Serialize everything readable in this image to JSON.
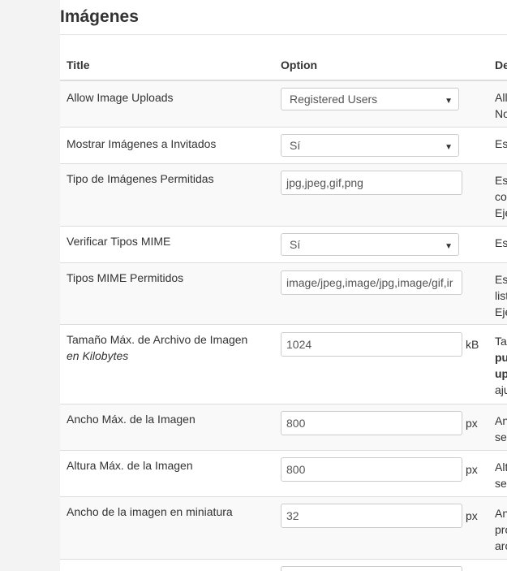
{
  "page": {
    "title": "Imágenes"
  },
  "table": {
    "headers": {
      "title": "Title",
      "option": "Option",
      "description": "De"
    },
    "rows": [
      {
        "title": "Allow Image Uploads",
        "control": "select",
        "value": "Registered Users",
        "desc": [
          "All",
          "No"
        ]
      },
      {
        "title": "Mostrar Imágenes a Invitados",
        "control": "select",
        "value": "Sí",
        "desc": [
          "Es"
        ]
      },
      {
        "title": "Tipo de Imágenes Permitidas",
        "control": "input",
        "value": "jpg,jpeg,gif,png",
        "desc": [
          "Es",
          "co",
          "Eje"
        ]
      },
      {
        "title": "Verificar Tipos MIME",
        "control": "select",
        "value": "Sí",
        "desc": [
          "Es"
        ]
      },
      {
        "title": "Tipos MIME Permitidos",
        "control": "input",
        "value": "image/jpeg,image/jpg,image/gif,ir",
        "desc": [
          "Es",
          "list",
          "Eje"
        ]
      },
      {
        "title": "Tamaño Máx. de Archivo de Imagen",
        "subtitle": "en Kilobytes",
        "control": "input",
        "value": "1024",
        "unit": "kB",
        "desc": [
          "Ta",
          "pu",
          "up",
          "aju"
        ]
      },
      {
        "title": "Ancho Máx. de la Imagen",
        "control": "input",
        "value": "800",
        "unit": "px",
        "desc": [
          "An",
          "se"
        ]
      },
      {
        "title": "Altura Máx. de la Imagen",
        "control": "input",
        "value": "800",
        "unit": "px",
        "desc": [
          "Alt",
          "se"
        ]
      },
      {
        "title": "Ancho de la imagen en miniatura",
        "control": "input",
        "value": "32",
        "unit": "px",
        "desc": [
          "An",
          "pro",
          "arc"
        ]
      }
    ]
  }
}
